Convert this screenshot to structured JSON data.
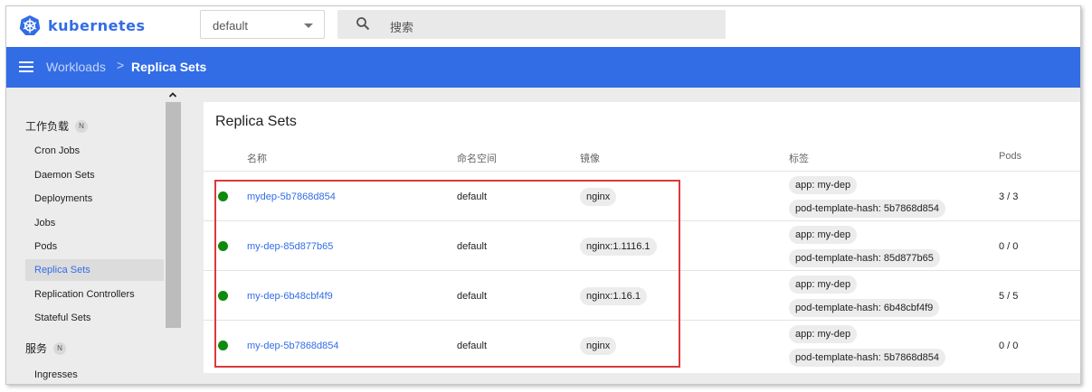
{
  "app": {
    "logo_text": "kubernetes",
    "logo_icon": "kubernetes-helm-icon",
    "accent": "#326de6"
  },
  "namespace_select": {
    "value": "default"
  },
  "search": {
    "placeholder": "搜索",
    "icon": "search-icon"
  },
  "breadcrumb": {
    "parent": "Workloads",
    "separator": ">",
    "current": "Replica Sets"
  },
  "sidebar": {
    "sections": [
      {
        "label": "工作负载",
        "badge": "N"
      },
      {
        "label": "服务",
        "badge": "N"
      }
    ],
    "items": [
      {
        "label": "Cron Jobs"
      },
      {
        "label": "Daemon Sets"
      },
      {
        "label": "Deployments"
      },
      {
        "label": "Jobs"
      },
      {
        "label": "Pods"
      },
      {
        "label": "Replica Sets",
        "active": true
      },
      {
        "label": "Replication Controllers"
      },
      {
        "label": "Stateful Sets"
      },
      {
        "label": "Ingresses"
      }
    ]
  },
  "card": {
    "title": "Replica Sets",
    "columns": [
      "名称",
      "命名空间",
      "镜像",
      "标签",
      "Pods"
    ],
    "rows": [
      {
        "status": "running",
        "name": "mydep-5b7868d854",
        "namespace": "default",
        "image": "nginx",
        "labels": [
          "app: my-dep",
          "pod-template-hash: 5b7868d854"
        ],
        "pods": "3 / 3"
      },
      {
        "status": "running",
        "name": "my-dep-85d877b65",
        "namespace": "default",
        "image": "nginx:1.1116.1",
        "labels": [
          "app: my-dep",
          "pod-template-hash: 85d877b65"
        ],
        "pods": "0 / 0"
      },
      {
        "status": "running",
        "name": "my-dep-6b48cbf4f9",
        "namespace": "default",
        "image": "nginx:1.16.1",
        "labels": [
          "app: my-dep",
          "pod-template-hash: 6b48cbf4f9"
        ],
        "pods": "5 / 5"
      },
      {
        "status": "running",
        "name": "my-dep-5b7868d854",
        "namespace": "default",
        "image": "nginx",
        "labels": [
          "app: my-dep",
          "pod-template-hash: 5b7868d854"
        ],
        "pods": "0 / 0"
      }
    ]
  },
  "colors": {
    "status_ok": "#0f8a0f",
    "highlight_border": "#d93a3a"
  }
}
